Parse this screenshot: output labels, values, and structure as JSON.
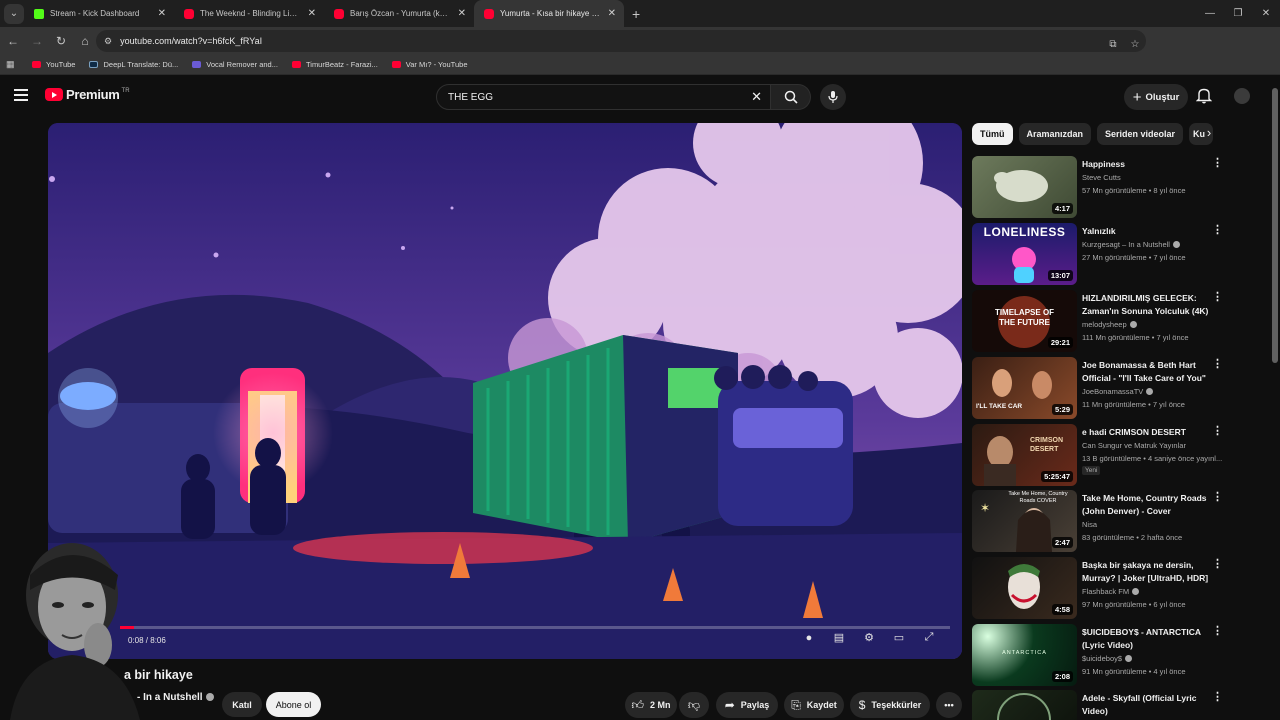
{
  "browser": {
    "tabs": [
      {
        "title": "Stream - Kick Dashboard",
        "icon": "kick-icon",
        "active": false
      },
      {
        "title": "The Weeknd - Blinding Lights (Of",
        "icon": "youtube-icon",
        "active": false
      },
      {
        "title": "Barış Özcan - Yumurta (kendi se",
        "icon": "youtube-icon",
        "active": false
      },
      {
        "title": "Yumurta - Kısa bir hikaye - You",
        "icon": "youtube-icon",
        "active": true
      }
    ],
    "url": "youtube.com/watch?v=h6fcK_fRYaI",
    "bookmarks": [
      {
        "label": "YouTube",
        "icon": "youtube-icon"
      },
      {
        "label": "DeepL Translate: Dü...",
        "icon": "deepl-icon"
      },
      {
        "label": "Vocal Remover and...",
        "icon": "vocal-remover-icon"
      },
      {
        "label": "TimurBeatz - Farazi...",
        "icon": "youtube-icon"
      },
      {
        "label": "Var Mı? - YouTube",
        "icon": "youtube-icon"
      }
    ]
  },
  "header": {
    "logo_text": "Premium",
    "logo_region": "TR",
    "search_value": "THE EGG",
    "create_label": "Oluştur"
  },
  "player": {
    "time": "0:08 / 8:06",
    "progress_fraction": 0.0165
  },
  "video": {
    "title_visible": "a bir hikaye",
    "channel_visible": "- In a Nutshell",
    "join_label": "Katıl",
    "subscribe_label": "Abone ol",
    "like_count": "2 Mn",
    "share_label": "Paylaş",
    "save_label": "Kaydet",
    "thanks_label": "Teşekkürler"
  },
  "chips": [
    "Tümü",
    "Aramanızdan",
    "Seriden videolar",
    "Ku"
  ],
  "recommendations": [
    {
      "title": "Happiness",
      "channel": "Steve Cutts",
      "meta": "57 Mn görüntüleme • 8 yıl önce",
      "duration": "4:17",
      "verified": false,
      "badge": ""
    },
    {
      "title": "Yalnızlık",
      "channel": "Kurzgesagt – In a Nutshell",
      "meta": "27 Mn görüntüleme • 7 yıl önce",
      "duration": "13:07",
      "verified": true,
      "badge": "",
      "thumb_text": "LONELINESS"
    },
    {
      "title": "HIZLANDIRILMIŞ GELECEK: Zaman'ın Sonuna Yolculuk (4K)",
      "channel": "melodysheep",
      "meta": "111 Mn görüntüleme • 7 yıl önce",
      "duration": "29:21",
      "verified": true,
      "badge": "",
      "thumb_text": "TIMELAPSE OF THE FUTURE"
    },
    {
      "title": "Joe Bonamassa & Beth Hart Official - \"I'll Take Care of You\" ...",
      "channel": "JoeBonamassaTV",
      "meta": "11 Mn görüntüleme • 7 yıl önce",
      "duration": "5:29",
      "verified": true,
      "badge": "",
      "thumb_text": "I'LL TAKE CAR"
    },
    {
      "title": "e hadi CRIMSON DESERT",
      "channel": "Can Sungur ve Matruk Yayınlar",
      "meta": "13 B görüntüleme • 4 saniye önce yayınl...",
      "duration": "5:25:47",
      "verified": false,
      "badge": "Yeni",
      "thumb_text": "CRIMSON DESERT"
    },
    {
      "title": "Take Me Home, Country Roads (John Denver) - Cover",
      "channel": "Nisa",
      "meta": "83 görüntüleme • 2 hafta önce",
      "duration": "2:47",
      "verified": false,
      "badge": "",
      "thumb_text": "Take Me Home, Country Roads COVER"
    },
    {
      "title": "Başka bir şakaya ne dersin, Murray? | Joker [UltraHD, HDR]",
      "channel": "Flashback FM",
      "meta": "97 Mn görüntüleme • 6 yıl önce",
      "duration": "4:58",
      "verified": true,
      "badge": ""
    },
    {
      "title": "$UICIDEBOY$ - ANTARCTICA (Lyric Video)",
      "channel": "$uicideboy$",
      "meta": "91 Mn görüntüleme • 4 yıl önce",
      "duration": "2:08",
      "verified": true,
      "badge": "",
      "thumb_text": "ANTARCTICA"
    },
    {
      "title": "Adele - Skyfall (Official Lyric Video)",
      "channel": "",
      "meta": "",
      "duration": "",
      "verified": false,
      "badge": ""
    }
  ],
  "colors": {
    "brand_red": "#ff0033",
    "background": "#0f0f0f",
    "chip_bg": "#272727"
  }
}
